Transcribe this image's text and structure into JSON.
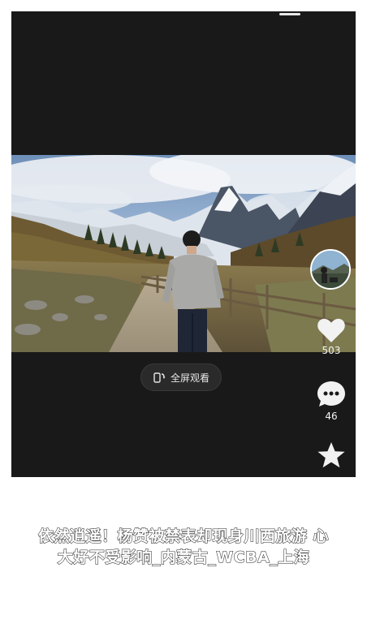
{
  "fullscreen_label": "全屏观看",
  "actions": {
    "likes": "503",
    "comments": "46",
    "favorites": ""
  },
  "caption": {
    "line1": "依然逍遥！杨赞被禁表却现身川西旅游 心",
    "line2": "大好不受影响_内蒙古_WCBA_上海"
  },
  "icons": {
    "like": "heart-icon",
    "comment": "comment-bubble-icon",
    "favorite": "star-icon",
    "fullscreen": "rotate-phone-icon"
  },
  "colors": {
    "app_bg": "#191919",
    "icon": "#f2f2f2",
    "button_bg": "#2a2a2a"
  }
}
